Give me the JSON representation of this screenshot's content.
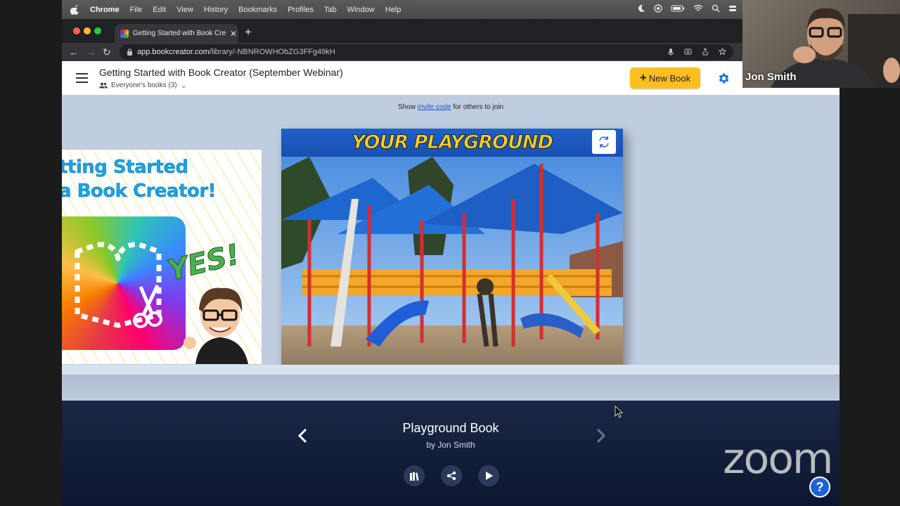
{
  "menubar": {
    "items": [
      "Chrome",
      "File",
      "Edit",
      "View",
      "History",
      "Bookmarks",
      "Profiles",
      "Tab",
      "Window",
      "Help"
    ]
  },
  "browser": {
    "tab_title": "Getting Started with Book Creator",
    "url_host": "app.bookcreator.com",
    "url_path": "/library/-NBNROWHObZG3FFg49kH"
  },
  "header": {
    "library_title": "Getting Started with Book Creator (September Webinar)",
    "library_sub": "Everyone's books (3)",
    "new_book_label": "New Book"
  },
  "shelf": {
    "invite_prefix": "Show ",
    "invite_link": "invite code",
    "invite_suffix": " for others to join",
    "left_book_line1": "tting Started",
    "left_book_line2": "a Book Creator!",
    "left_book_yes": "YES!",
    "main_book_banner": "YOUR PLAYGROUND"
  },
  "details": {
    "book_title": "Playground Book",
    "author": "by Jon Smith"
  },
  "zoom": {
    "participant": "Jon Smith",
    "logo": "zoom",
    "help": "?"
  },
  "colors": {
    "accent_yellow": "#fbbf24",
    "brand_blue": "#1e63d6",
    "shelf_bg": "#c0cde0",
    "panel_bg": "#1a2744"
  }
}
